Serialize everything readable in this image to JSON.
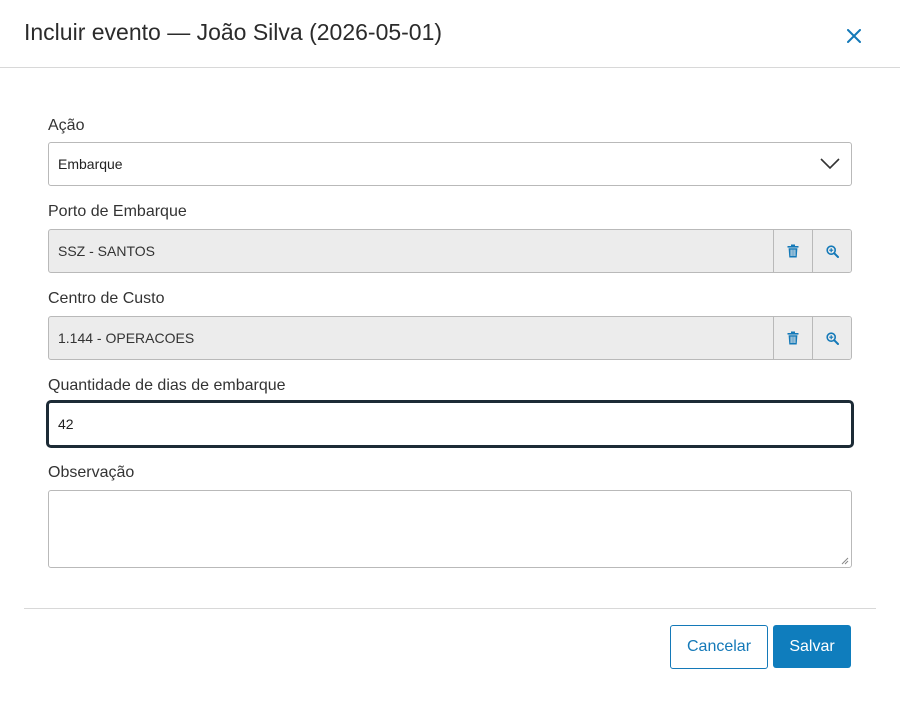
{
  "dialog": {
    "title": "Incluir evento — João Silva (2026-05-01)",
    "close_icon": "close-icon"
  },
  "form": {
    "acao": {
      "label": "Ação",
      "selected": "Embarque"
    },
    "porto": {
      "label": "Porto de Embarque",
      "value": "SSZ - SANTOS"
    },
    "centro_custo": {
      "label": "Centro de Custo",
      "value": "1.144 - OPERACOES"
    },
    "quantidade_dias": {
      "label": "Quantidade de dias de embarque",
      "value": "42"
    },
    "observacao": {
      "label": "Observação",
      "value": ""
    }
  },
  "footer": {
    "cancel_label": "Cancelar",
    "save_label": "Salvar"
  },
  "colors": {
    "accent": "#0f7dbd",
    "readonly_bg": "#ececec",
    "focus_border": "#1d2b36"
  }
}
